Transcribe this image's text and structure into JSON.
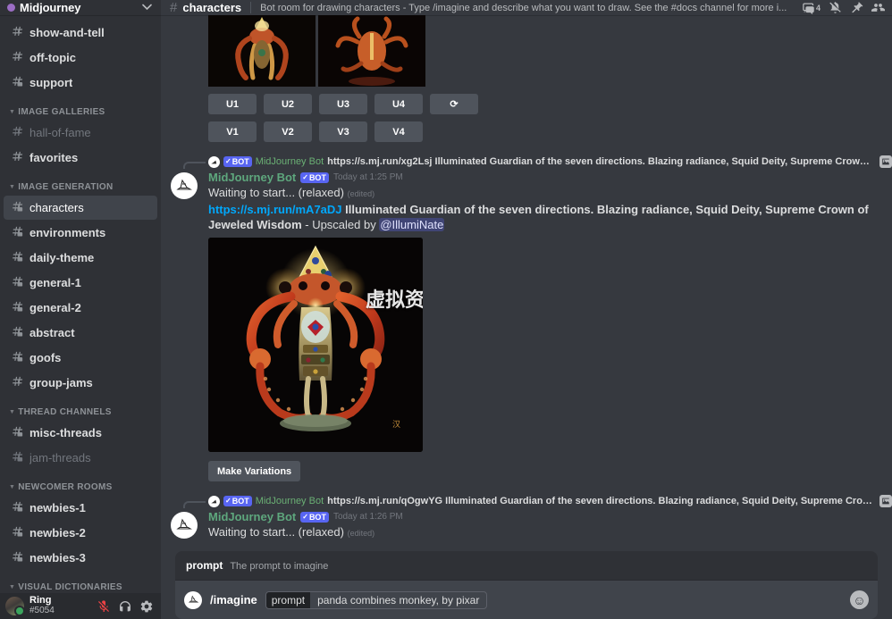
{
  "server": {
    "name": "Midjourney",
    "dropdown_icon": "chevron-down-icon"
  },
  "sidebar": {
    "groups": [
      {
        "label": "",
        "channels": [
          {
            "name": "show-and-tell",
            "icon": "hash-icon",
            "state": "loud"
          },
          {
            "name": "off-topic",
            "icon": "hash-icon",
            "state": "loud"
          },
          {
            "name": "support",
            "icon": "hash-thread-icon",
            "state": "loud"
          }
        ]
      },
      {
        "label": "IMAGE GALLERIES",
        "channels": [
          {
            "name": "hall-of-fame",
            "icon": "hash-icon",
            "state": "muted"
          },
          {
            "name": "favorites",
            "icon": "hash-icon",
            "state": "loud"
          }
        ]
      },
      {
        "label": "IMAGE GENERATION",
        "channels": [
          {
            "name": "characters",
            "icon": "hash-thread-icon",
            "state": "active"
          },
          {
            "name": "environments",
            "icon": "hash-thread-icon",
            "state": "loud"
          },
          {
            "name": "daily-theme",
            "icon": "hash-thread-icon",
            "state": "loud"
          },
          {
            "name": "general-1",
            "icon": "hash-thread-icon",
            "state": "loud"
          },
          {
            "name": "general-2",
            "icon": "hash-thread-icon",
            "state": "loud"
          },
          {
            "name": "abstract",
            "icon": "hash-thread-icon",
            "state": "loud"
          },
          {
            "name": "goofs",
            "icon": "hash-thread-icon",
            "state": "loud"
          },
          {
            "name": "group-jams",
            "icon": "hash-icon",
            "state": "loud"
          }
        ]
      },
      {
        "label": "THREAD CHANNELS",
        "channels": [
          {
            "name": "misc-threads",
            "icon": "hash-thread-icon",
            "state": "loud"
          },
          {
            "name": "jam-threads",
            "icon": "hash-thread-icon",
            "state": "muted"
          }
        ]
      },
      {
        "label": "NEWCOMER ROOMS",
        "channels": [
          {
            "name": "newbies-1",
            "icon": "hash-thread-icon",
            "state": "loud"
          },
          {
            "name": "newbies-2",
            "icon": "hash-thread-icon",
            "state": "loud"
          },
          {
            "name": "newbies-3",
            "icon": "hash-thread-icon",
            "state": "loud"
          }
        ]
      },
      {
        "label": "VISUAL DICTIONARIES",
        "channels": []
      }
    ]
  },
  "user_panel": {
    "name": "Ring",
    "tag": "#5054",
    "mic_icon": "microphone-muted-icon",
    "headset_icon": "headphones-icon",
    "settings_icon": "gear-icon"
  },
  "topbar": {
    "hash_icon": "hash-icon",
    "channel": "characters",
    "topic": "Bot room for drawing characters - Type /imagine and describe what you want to draw. See the #docs channel for more i...",
    "threads_icon": "threads-icon",
    "threads_count": "4",
    "notifications_icon": "bell-slash-icon",
    "pinned_icon": "pin-icon",
    "members_icon": "members-icon"
  },
  "messages": {
    "grid_buttons_row1": [
      "U1",
      "U2",
      "U3",
      "U4"
    ],
    "refresh_label": "⟳",
    "grid_buttons_row2": [
      "V1",
      "V2",
      "V3",
      "V4"
    ],
    "items": [
      {
        "reply": {
          "bot_badge": "BOT",
          "author": "MidJourney Bot",
          "text": "https://s.mj.run/xg2Lsj Illuminated Guardian of the seven directions. Blazing radiance, Squid Deity, Supreme Crown of Je...",
          "attachment_icon": "image-attachment-icon"
        },
        "author": "MidJourney Bot",
        "bot_badge": "BOT",
        "timestamp": "Today at 1:25 PM",
        "status_text": "Waiting to start... (relaxed)",
        "edited_label": "(edited)",
        "link": "https://s.mj.run/mA7aDJ",
        "prompt_text": "Illuminated Guardian of the seven directions. Blazing radiance, Squid Deity, Supreme Crown of Jeweled Wisdom",
        "upscaled_by_label": " - Upscaled by ",
        "upscaled_by_user": "@IllumiNate",
        "image_watermark": "虚拟资源网",
        "action_button": "Make Variations"
      },
      {
        "reply": {
          "bot_badge": "BOT",
          "author": "MidJourney Bot",
          "text": "https://s.mj.run/qOgwYG Illuminated Guardian of the seven directions. Blazing radiance, Squid Deity, Supreme Crown of...",
          "attachment_icon": "image-attachment-icon"
        },
        "author": "MidJourney Bot",
        "bot_badge": "BOT",
        "timestamp": "Today at 1:26 PM",
        "status_text": "Waiting to start... (relaxed)",
        "edited_label": "(edited)"
      }
    ]
  },
  "composer": {
    "hint_key": "prompt",
    "hint_desc": "The prompt to imagine",
    "command": "/imagine",
    "option_key": "prompt",
    "option_value": "panda combines monkey, by pixar",
    "emoji_icon": "emoji-icon"
  },
  "colors": {
    "sidebar_bg": "#2f3136",
    "main_bg": "#36393f",
    "accent_blurple": "#5865f2",
    "link_blue": "#00a8fc",
    "bot_green": "#5ea77d",
    "button_gray": "#4f545c"
  }
}
